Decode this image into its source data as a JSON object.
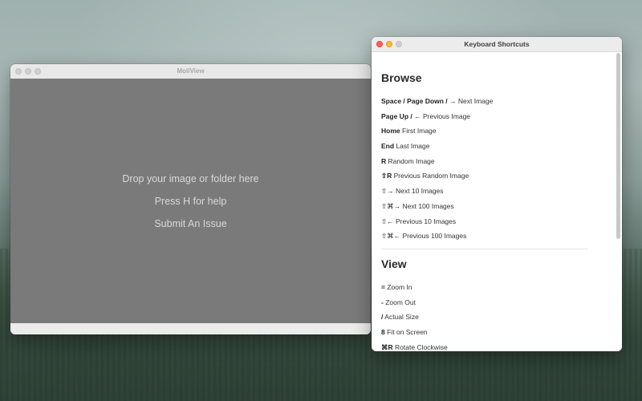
{
  "desktop": {
    "wallpaper_colors": [
      "#a7b7b4",
      "#58705f",
      "#34493d"
    ]
  },
  "moliview_window": {
    "title": "MoliView",
    "canvas_color": "#7a7a7a",
    "hints": {
      "drop": "Drop your image or folder here",
      "help": "Press H for help",
      "issue": "Submit An Issue"
    }
  },
  "shortcuts_window": {
    "title": "Keyboard Shortcuts",
    "sections": {
      "browse": {
        "title": "Browse",
        "items": [
          {
            "keys": "Space / Page Down / →",
            "desc": "Next Image"
          },
          {
            "keys": "Page Up / ←",
            "desc": "Previous Image"
          },
          {
            "keys": "Home",
            "desc": "First Image"
          },
          {
            "keys": "End",
            "desc": "Last Image"
          },
          {
            "keys": "R",
            "desc": "Random Image"
          },
          {
            "keys": "⇧R",
            "desc": "Previous Random Image"
          },
          {
            "keys": "⇧→",
            "desc": "Next 10 Images"
          },
          {
            "keys": "⇧⌘→",
            "desc": "Next 100 Images"
          },
          {
            "keys": "⇧←",
            "desc": "Previous 10 Images"
          },
          {
            "keys": "⇧⌘←",
            "desc": "Previous 100 Images"
          }
        ]
      },
      "view": {
        "title": "View",
        "items": [
          {
            "keys": "=",
            "desc": "Zoom In"
          },
          {
            "keys": "-",
            "desc": "Zoom Out"
          },
          {
            "keys": "/",
            "desc": "Actual Size"
          },
          {
            "keys": "8",
            "desc": "Fit on Screen"
          },
          {
            "keys": "⌘R",
            "desc": "Rotate Clockwise"
          }
        ]
      }
    }
  }
}
